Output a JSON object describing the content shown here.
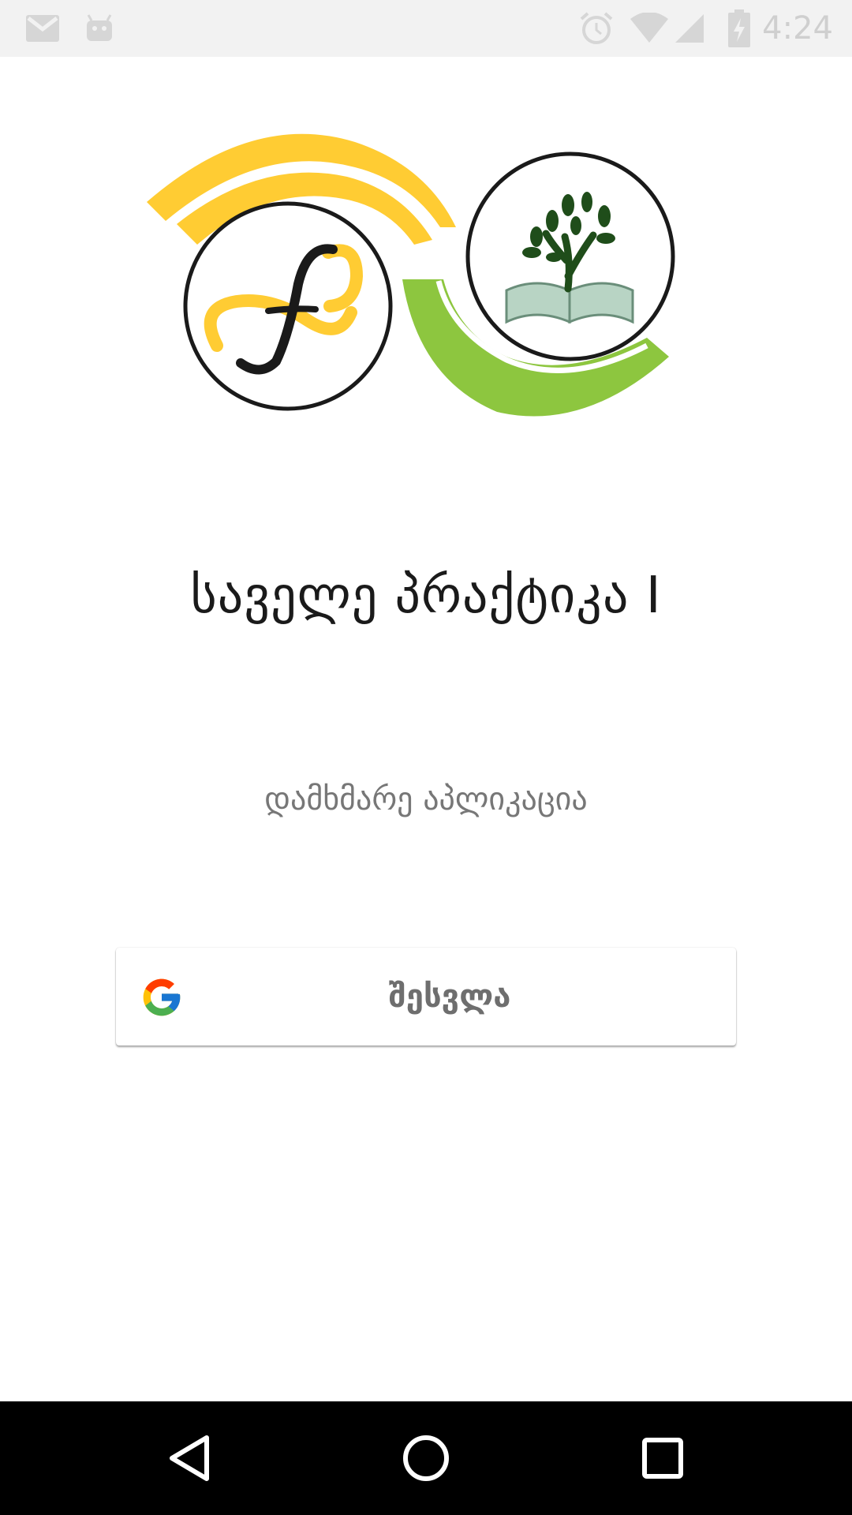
{
  "status_bar": {
    "time": "4:24",
    "icons": [
      "gmail-icon",
      "android-icon",
      "alarm-icon",
      "wifi-icon",
      "signal-icon",
      "battery-charging-icon"
    ]
  },
  "logo": {
    "icon": "app-logo"
  },
  "title": "საველე პრაქტიკა I",
  "subtitle": "დამხმარე აპლიკაცია",
  "signin": {
    "label": "შესვლა",
    "icon": "google-icon"
  },
  "nav_bar": {
    "icons": [
      "back-icon",
      "home-icon",
      "recents-icon"
    ]
  },
  "colors": {
    "yellow": "#FFCC33",
    "green": "#8DC63F",
    "dark_green": "#1F4D1A"
  }
}
